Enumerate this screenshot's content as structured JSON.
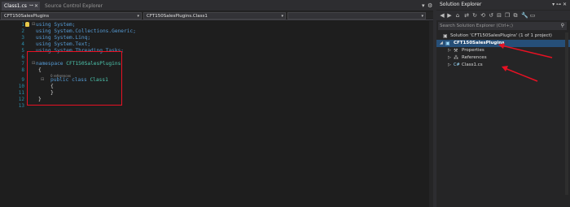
{
  "editor": {
    "tabs": [
      {
        "label": "Class1.cs",
        "active": true
      },
      {
        "label": "Source Control Explorer",
        "active": false
      }
    ],
    "nav": {
      "project_combo": "CFT150SalesPlugins",
      "type_combo": "CFT150SalesPlugins.Class1",
      "member_combo": ""
    },
    "line_numbers": [
      "1",
      "2",
      "3",
      "4",
      "5",
      "6",
      "7",
      "8",
      "9",
      "10",
      "11",
      "12",
      "13"
    ],
    "code": {
      "l1": "using System;",
      "l2": "using System.Collections.Generic;",
      "l3": "using System.Linq;",
      "l4": "using System.Text;",
      "l5": "using System.Threading.Tasks;",
      "l7_kw": "namespace",
      "l7_name": "CFT150SalesPlugins",
      "l8": "{",
      "codelens": "0 references",
      "l9_kw": "public class",
      "l9_name": "Class1",
      "l10": "{",
      "l11": "}",
      "l12": "}"
    }
  },
  "solution_explorer": {
    "title": "Solution Explorer",
    "search_placeholder": "Search Solution Explorer (Ctrl+;)",
    "items": [
      {
        "label": "Solution 'CFT150SalesPlugins' (1 of 1 project)"
      },
      {
        "label": "CFT150SalesPlugins"
      },
      {
        "label": "Properties"
      },
      {
        "label": "References"
      },
      {
        "label": "Class1.cs"
      }
    ]
  },
  "colors": {
    "highlight_box": "#e81123",
    "selected_row": "#264f78"
  }
}
